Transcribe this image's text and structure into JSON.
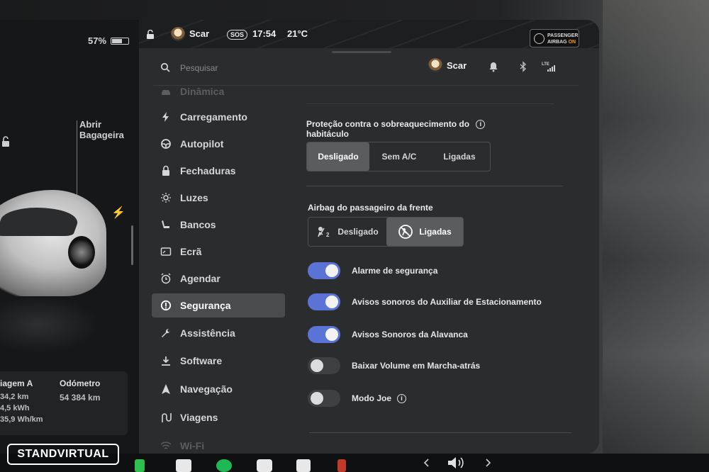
{
  "status_bar": {
    "battery_percent": "57%",
    "profile_name": "Scar",
    "sos_label": "SOS",
    "time": "17:54",
    "temperature": "21°C",
    "airbag_status_line1": "PASSENGER",
    "airbag_status_line2": "AIRBAG",
    "airbag_status_on": "ON"
  },
  "car_panel": {
    "trunk_label_line1": "Abrir",
    "trunk_label_line2": "Bagageira",
    "trip_header": "iagem A",
    "trip_values": [
      "34,2 km",
      "4,5 kWh",
      "35,9 Wh/km"
    ],
    "odometer_header": "Odómetro",
    "odometer_value": "54 384 km"
  },
  "topbar": {
    "search_placeholder": "Pesquisar",
    "profile_name": "Scar"
  },
  "sidebar": {
    "items": [
      {
        "label": "Dinâmica",
        "icon": "car-icon"
      },
      {
        "label": "Carregamento",
        "icon": "bolt-icon"
      },
      {
        "label": "Autopilot",
        "icon": "steering-wheel-icon"
      },
      {
        "label": "Fechaduras",
        "icon": "lock-icon"
      },
      {
        "label": "Luzes",
        "icon": "sun-icon"
      },
      {
        "label": "Bancos",
        "icon": "seat-icon"
      },
      {
        "label": "Ecrã",
        "icon": "display-icon"
      },
      {
        "label": "Agendar",
        "icon": "alarm-clock-icon"
      },
      {
        "label": "Segurança",
        "icon": "alert-circle-icon"
      },
      {
        "label": "Assistência",
        "icon": "wrench-icon"
      },
      {
        "label": "Software",
        "icon": "download-icon"
      },
      {
        "label": "Navegação",
        "icon": "navigation-arrow-icon"
      },
      {
        "label": "Viagens",
        "icon": "route-icon"
      },
      {
        "label": "Wi-Fi",
        "icon": "wifi-icon"
      }
    ],
    "active_index": 8
  },
  "cabin_overheat": {
    "title_line1": "Proteção contra o sobreaquecimento do",
    "title_line2": "habitáculo",
    "options": [
      "Desligado",
      "Sem A/C",
      "Ligadas"
    ],
    "selected": "Desligado"
  },
  "passenger_airbag": {
    "title": "Airbag do passageiro da frente",
    "options": [
      "Desligado",
      "Ligadas"
    ],
    "selected": "Ligadas"
  },
  "toggles": [
    {
      "label": "Alarme de segurança",
      "on": true
    },
    {
      "label": "Avisos sonoros do Auxiliar de Estacionamento",
      "on": true
    },
    {
      "label": "Avisos Sonoros da Alavanca",
      "on": true
    },
    {
      "label": "Baixar Volume em Marcha-atrás",
      "on": false
    },
    {
      "label": "Modo Joe",
      "on": false
    }
  ],
  "colors": {
    "toggle_on": "#5c73d6",
    "panel_bg": "#2b2c2e",
    "selected_segment": "#5b5c5e"
  },
  "watermark": "STANDVIRTUAL"
}
